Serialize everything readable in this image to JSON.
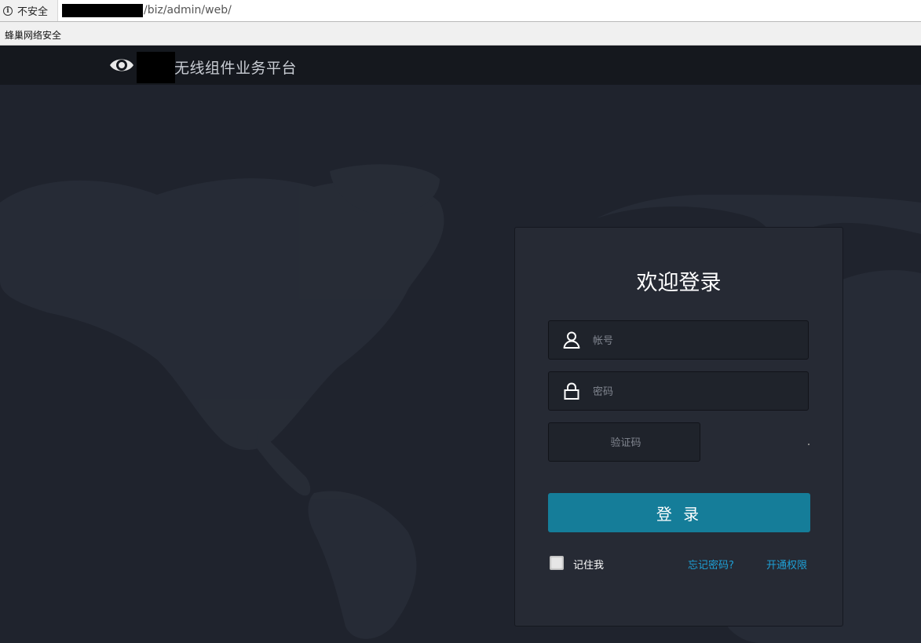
{
  "browser": {
    "security_label": "不安全",
    "url_path": "/biz/admin/web/",
    "bookmark": "蜂巢网络安全"
  },
  "header": {
    "app_title": "无线组件业务平台"
  },
  "login": {
    "title": "欢迎登录",
    "account_placeholder": "帐号",
    "password_placeholder": "密码",
    "captcha_placeholder": "验证码",
    "submit_label": "登 录",
    "remember_label": "记住我",
    "forgot_label": "忘记密码?",
    "activate_label": "开通权限"
  },
  "colors": {
    "background": "#1f232d",
    "header": "#15181e",
    "panel": "#262a34",
    "accent": "#157d99",
    "link": "#1ea0d6"
  },
  "icons": [
    "info-icon",
    "eye-icon",
    "user-icon",
    "lock-icon"
  ]
}
